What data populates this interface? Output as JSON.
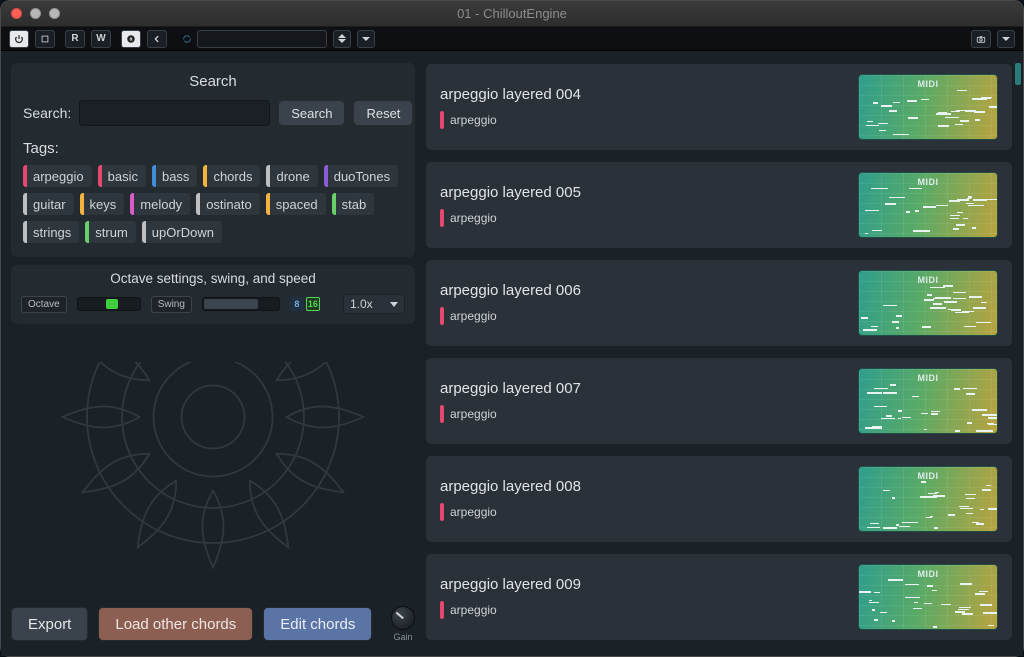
{
  "window": {
    "title": "01 - ChilloutEngine"
  },
  "header": {
    "buttons": {
      "r": "R",
      "w": "W"
    }
  },
  "search": {
    "title": "Search",
    "label": "Search:",
    "button": "Search",
    "reset": "Reset"
  },
  "tags": {
    "header": "Tags:",
    "items": [
      {
        "label": "arpeggio",
        "color": "#e6476f"
      },
      {
        "label": "basic",
        "color": "#e6476f"
      },
      {
        "label": "bass",
        "color": "#3f8ed6"
      },
      {
        "label": "chords",
        "color": "#f4b23e"
      },
      {
        "label": "drone",
        "color": "#bfbfbf"
      },
      {
        "label": "duoTones",
        "color": "#8a5cd6"
      },
      {
        "label": "guitar",
        "color": "#bfbfbf"
      },
      {
        "label": "keys",
        "color": "#f4b23e"
      },
      {
        "label": "melody",
        "color": "#d85cc7"
      },
      {
        "label": "ostinato",
        "color": "#bfbfbf"
      },
      {
        "label": "spaced",
        "color": "#f4b23e"
      },
      {
        "label": "stab",
        "color": "#69cf69"
      },
      {
        "label": "strings",
        "color": "#bfbfbf"
      },
      {
        "label": "strum",
        "color": "#69cf69"
      },
      {
        "label": "upOrDown",
        "color": "#bfbfbf"
      }
    ]
  },
  "settings": {
    "title": "Octave settings, swing, and speed",
    "octave_label": "Octave",
    "swing_label": "Swing",
    "swing_8": "8",
    "swing_16": "16",
    "speed": "1.0x"
  },
  "bottom": {
    "export": "Export",
    "load": "Load other chords",
    "edit": "Edit chords",
    "gain": "Gain"
  },
  "results": [
    {
      "name": "arpeggio layered 004",
      "tags": [
        {
          "label": "arpeggio",
          "color": "#e6476f"
        }
      ],
      "midi": "MIDI"
    },
    {
      "name": "arpeggio layered 005",
      "tags": [
        {
          "label": "arpeggio",
          "color": "#e6476f"
        }
      ],
      "midi": "MIDI"
    },
    {
      "name": "arpeggio layered 006",
      "tags": [
        {
          "label": "arpeggio",
          "color": "#e6476f"
        }
      ],
      "midi": "MIDI"
    },
    {
      "name": "arpeggio layered 007",
      "tags": [
        {
          "label": "arpeggio",
          "color": "#e6476f"
        }
      ],
      "midi": "MIDI"
    },
    {
      "name": "arpeggio layered 008",
      "tags": [
        {
          "label": "arpeggio",
          "color": "#e6476f"
        }
      ],
      "midi": "MIDI"
    },
    {
      "name": "arpeggio layered 009",
      "tags": [
        {
          "label": "arpeggio",
          "color": "#e6476f"
        }
      ],
      "midi": "MIDI"
    }
  ]
}
